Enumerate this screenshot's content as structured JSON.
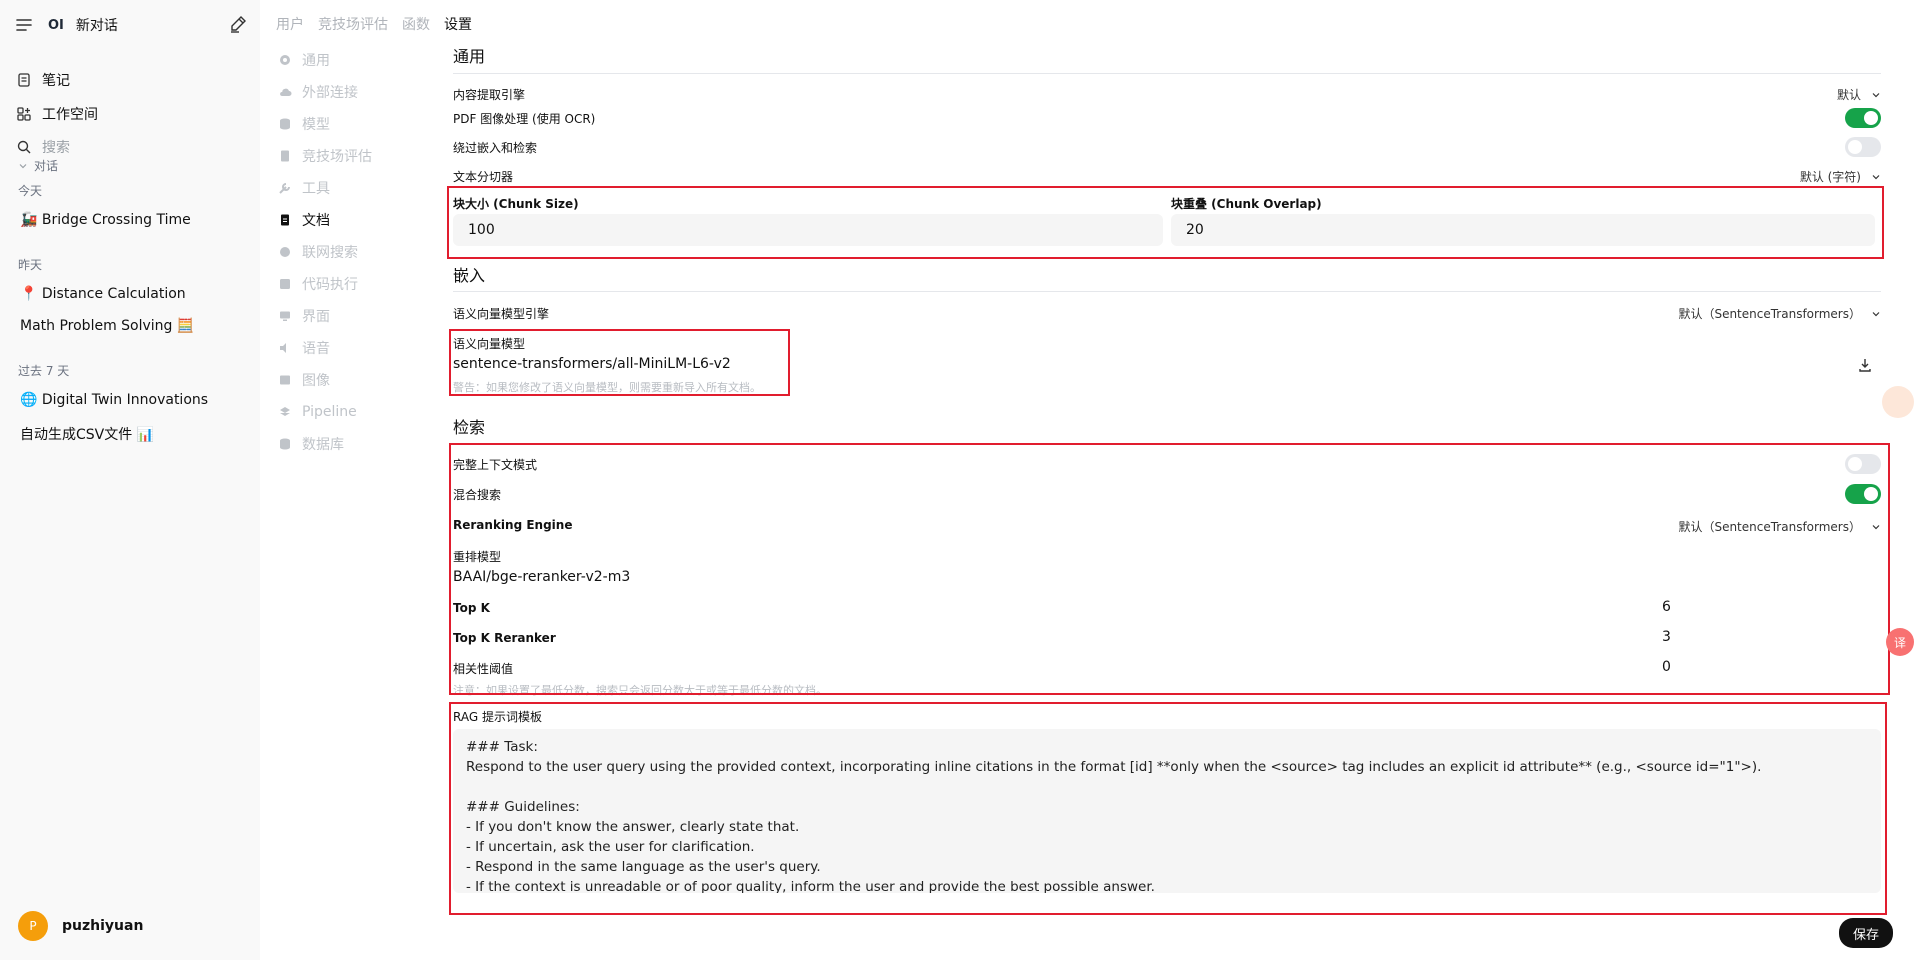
{
  "sidebar": {
    "new_chat": "新对话",
    "logo": "OI",
    "nav": [
      "笔记",
      "工作空间",
      "搜索"
    ],
    "section_label": "对话",
    "groups": [
      {
        "label": "今天",
        "chats": [
          "🚂 Bridge Crossing Time"
        ]
      },
      {
        "label": "昨天",
        "chats": [
          "📍 Distance Calculation",
          "Math Problem Solving 🧮"
        ]
      },
      {
        "label": "过去 7 天",
        "chats": [
          "🌐 Digital Twin Innovations",
          "自动生成CSV文件 📊"
        ]
      }
    ],
    "user": {
      "initial": "P",
      "name": "puzhiyuan"
    }
  },
  "admin_tabs": [
    "用户",
    "竞技场评估",
    "函数",
    "设置"
  ],
  "settings_nav": [
    "通用",
    "外部连接",
    "模型",
    "竞技场评估",
    "工具",
    "文档",
    "联网搜索",
    "代码执行",
    "界面",
    "语音",
    "图像",
    "Pipeline",
    "数据库"
  ],
  "general": {
    "heading": "通用",
    "content_engine_label": "内容提取引擎",
    "content_engine_value": "默认",
    "pdf_ocr_label": "PDF 图像处理 (使用 OCR)",
    "pdf_ocr_on": true,
    "bypass_label": "绕过嵌入和检索",
    "bypass_on": false,
    "splitter_label": "文本分切器",
    "splitter_value": "默认 (字符)",
    "chunk_size_label": "块大小 (Chunk Size)",
    "chunk_size": "100",
    "chunk_overlap_label": "块重叠 (Chunk Overlap)",
    "chunk_overlap": "20"
  },
  "embedding": {
    "heading": "嵌入",
    "engine_label": "语义向量模型引擎",
    "engine_value": "默认（SentenceTransformers）",
    "model_label": "语义向量模型",
    "model_value": "sentence-transformers/all-MiniLM-L6-v2",
    "warning": "警告：如果您修改了语义向量模型，则需要重新导入所有文档。"
  },
  "retrieval": {
    "heading": "检索",
    "full_context_label": "完整上下文模式",
    "full_context_on": false,
    "hybrid_label": "混合搜索",
    "hybrid_on": true,
    "rerank_engine_label": "Reranking Engine",
    "rerank_engine_value": "默认（SentenceTransformers）",
    "rerank_model_label": "重排模型",
    "rerank_model_value": "BAAI/bge-reranker-v2-m3",
    "topk_label": "Top K",
    "topk_value": "6",
    "topk_reranker_label": "Top K Reranker",
    "topk_reranker_value": "3",
    "threshold_label": "相关性阈值",
    "threshold_value": "0",
    "threshold_note": "注意：如果设置了最低分数，搜索只会返回分数大于或等于最低分数的文档。"
  },
  "rag": {
    "label": "RAG 提示词模板",
    "template": "### Task:\nRespond to the user query using the provided context, incorporating inline citations in the format [id] **only when the <source> tag includes an explicit id attribute** (e.g., <source id=\"1\">).\n\n### Guidelines:\n- If you don't know the answer, clearly state that.\n- If uncertain, ask the user for clarification.\n- Respond in the same language as the user's query.\n- If the context is unreadable or of poor quality, inform the user and provide the best possible answer."
  },
  "save_label": "保存",
  "translate_label": "译"
}
